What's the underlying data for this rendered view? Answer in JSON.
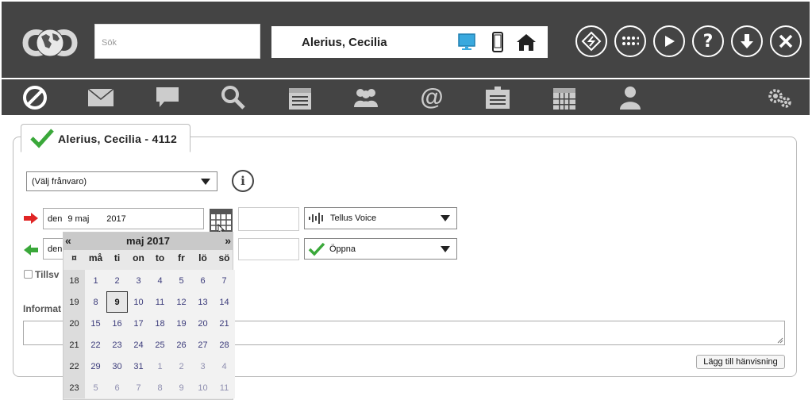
{
  "header": {
    "search_placeholder": "Sök",
    "user_name": "Alerius, Cecilia"
  },
  "tab": {
    "title": "Alerius, Cecilia - 4112"
  },
  "absence_select": "(Välj frånvaro)",
  "from_field": {
    "prefix": "den",
    "date": "9 maj",
    "year": "2017"
  },
  "to_field": {
    "prefix": "den"
  },
  "status_select_1": "Tellus Voice",
  "status_select_2": "Öppna",
  "checkbox_label": "Tillsv",
  "info_label": "Informat",
  "add_referral_button": "Lägg till hänvisning",
  "colors": {
    "accent_green": "#3aa83a",
    "red_arrow": "#e02424",
    "device_blue": "#3aa9de"
  },
  "calendar": {
    "prev": "«",
    "next": "»",
    "month_title": "maj 2017",
    "week_col_header": "¤",
    "weekdays": [
      "må",
      "ti",
      "on",
      "to",
      "fr",
      "lö",
      "sö"
    ],
    "selected": "9",
    "rows": [
      {
        "week": "18",
        "days": [
          {
            "d": "1",
            "o": 0
          },
          {
            "d": "2",
            "o": 0
          },
          {
            "d": "3",
            "o": 0
          },
          {
            "d": "4",
            "o": 0
          },
          {
            "d": "5",
            "o": 0
          },
          {
            "d": "6",
            "o": 0
          },
          {
            "d": "7",
            "o": 0
          }
        ]
      },
      {
        "week": "19",
        "days": [
          {
            "d": "8",
            "o": 0
          },
          {
            "d": "9",
            "o": 0
          },
          {
            "d": "10",
            "o": 0
          },
          {
            "d": "11",
            "o": 0
          },
          {
            "d": "12",
            "o": 0
          },
          {
            "d": "13",
            "o": 0
          },
          {
            "d": "14",
            "o": 0
          }
        ]
      },
      {
        "week": "20",
        "days": [
          {
            "d": "15",
            "o": 0
          },
          {
            "d": "16",
            "o": 0
          },
          {
            "d": "17",
            "o": 0
          },
          {
            "d": "18",
            "o": 0
          },
          {
            "d": "19",
            "o": 0
          },
          {
            "d": "20",
            "o": 0
          },
          {
            "d": "21",
            "o": 0
          }
        ]
      },
      {
        "week": "21",
        "days": [
          {
            "d": "22",
            "o": 0
          },
          {
            "d": "23",
            "o": 0
          },
          {
            "d": "24",
            "o": 0
          },
          {
            "d": "25",
            "o": 0
          },
          {
            "d": "26",
            "o": 0
          },
          {
            "d": "27",
            "o": 0
          },
          {
            "d": "28",
            "o": 0
          }
        ]
      },
      {
        "week": "22",
        "days": [
          {
            "d": "29",
            "o": 0
          },
          {
            "d": "30",
            "o": 0
          },
          {
            "d": "31",
            "o": 0
          },
          {
            "d": "1",
            "o": 1
          },
          {
            "d": "2",
            "o": 1
          },
          {
            "d": "3",
            "o": 1
          },
          {
            "d": "4",
            "o": 1
          }
        ]
      },
      {
        "week": "23",
        "days": [
          {
            "d": "5",
            "o": 1
          },
          {
            "d": "6",
            "o": 1
          },
          {
            "d": "7",
            "o": 1
          },
          {
            "d": "8",
            "o": 1
          },
          {
            "d": "9",
            "o": 1
          },
          {
            "d": "10",
            "o": 1
          },
          {
            "d": "11",
            "o": 1
          }
        ]
      }
    ]
  }
}
